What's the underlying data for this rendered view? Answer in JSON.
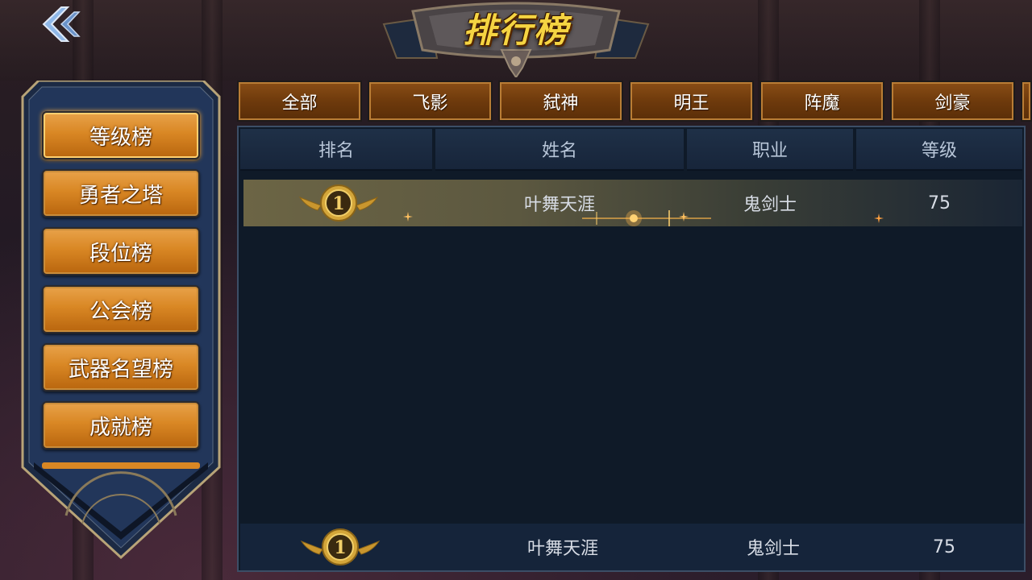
{
  "title": "排行榜",
  "left_menu": {
    "items": [
      {
        "label": "等级榜",
        "active": true
      },
      {
        "label": "勇者之塔",
        "active": false
      },
      {
        "label": "段位榜",
        "active": false
      },
      {
        "label": "公会榜",
        "active": false
      },
      {
        "label": "武器名望榜",
        "active": false
      },
      {
        "label": "成就榜",
        "active": false
      }
    ]
  },
  "class_tabs": [
    {
      "label": "全部"
    },
    {
      "label": "飞影"
    },
    {
      "label": "弑神"
    },
    {
      "label": "明王"
    },
    {
      "label": "阵魔"
    },
    {
      "label": "剑豪"
    }
  ],
  "table": {
    "headers": {
      "rank": "排名",
      "name": "姓名",
      "job": "职业",
      "level": "等级"
    },
    "rows": [
      {
        "rank": "1",
        "name": "叶舞天涯",
        "job": "鬼剑士",
        "level": "75"
      }
    ]
  },
  "self_row": {
    "rank": "1",
    "name": "叶舞天涯",
    "job": "鬼剑士",
    "level": "75"
  },
  "colors": {
    "button_orange": "#d98724",
    "tab_brown": "#6e3a0c",
    "panel_bg": "#0f1a28",
    "header_bg": "#1f3047",
    "title_gold": "#f5d442",
    "medal_gold": "#d4a63a"
  },
  "icons": {
    "back": "double-chevron-left-icon",
    "medal": "gold-winged-medal-icon"
  }
}
